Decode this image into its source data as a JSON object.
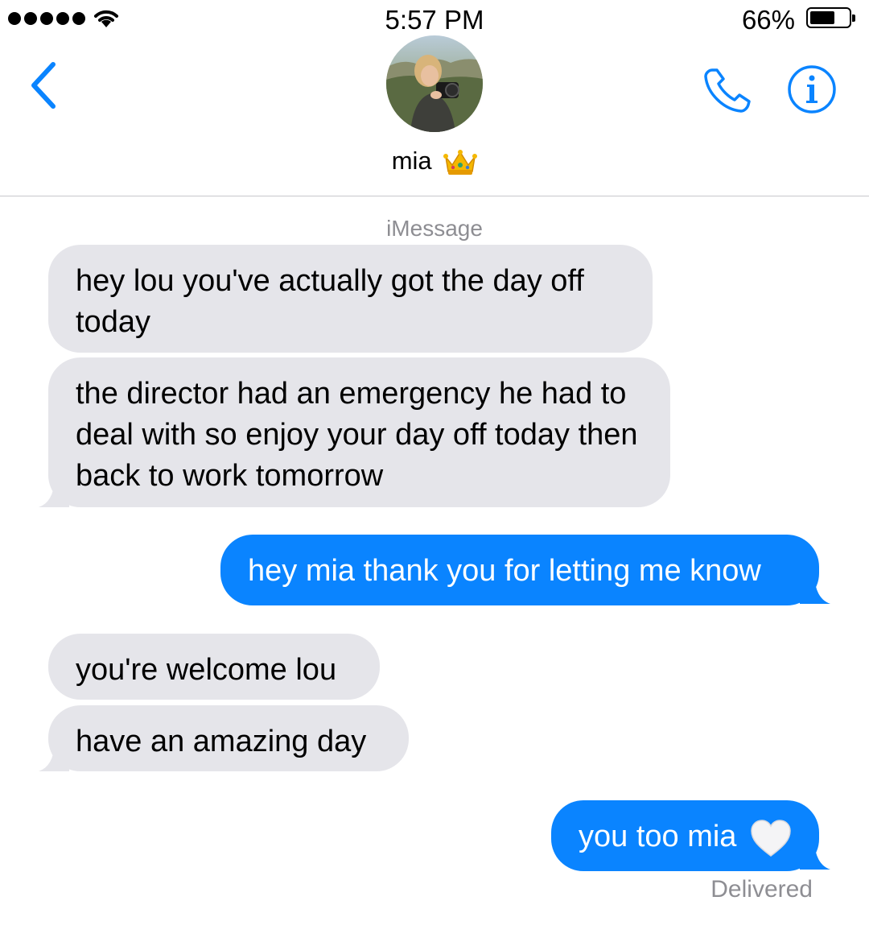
{
  "status_bar": {
    "time": "5:57 PM",
    "battery_percent": "66%",
    "battery_level": 0.66,
    "signal_bars": 5
  },
  "header": {
    "contact_name": "mia",
    "contact_emoji": "crown",
    "avatar": "photo",
    "back_icon": "chevron-left-icon",
    "call_icon": "phone-icon",
    "info_icon": "info-icon"
  },
  "conversation": {
    "service_label": "iMessage",
    "messages": [
      {
        "direction": "incoming",
        "text": "hey lou you've actually got the day off today"
      },
      {
        "direction": "incoming",
        "text": "the director had an emergency he had to deal with so enjoy your day off today then back to work tomorrow"
      },
      {
        "direction": "outgoing",
        "text": "hey mia thank you for letting me know"
      },
      {
        "direction": "incoming",
        "text": "you're welcome lou"
      },
      {
        "direction": "incoming",
        "text": "have an amazing day"
      },
      {
        "direction": "outgoing",
        "text": "you too mia",
        "emoji": "white-heart"
      }
    ],
    "receipt": "Delivered"
  },
  "colors": {
    "accent": "#0a84ff",
    "incoming_bubble": "#e5e5ea",
    "secondary_text": "#8e8e93"
  }
}
